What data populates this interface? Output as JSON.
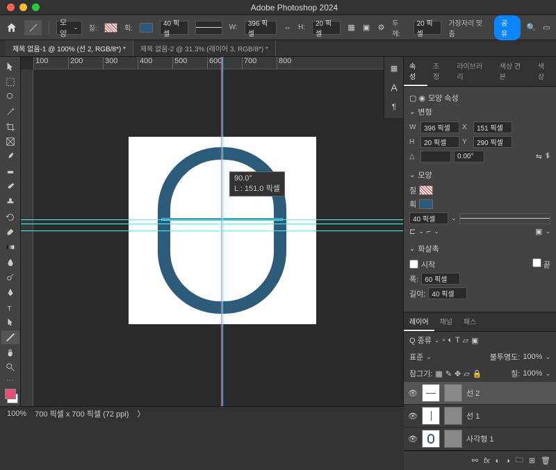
{
  "app": {
    "title": "Adobe Photoshop 2024"
  },
  "toolbar": {
    "shape_mode": "모양",
    "fill_label": "칠:",
    "stroke_label": "획:",
    "stroke_width": "40 픽셀",
    "w_label": "W:",
    "w_value": "396 픽셀",
    "h_label": "H:",
    "h_value": "20 픽셀",
    "thickness_label": "두께:",
    "thickness_value": "20 픽셀",
    "align_label": "가장자리 맞춤",
    "share": "공유"
  },
  "tabs": [
    {
      "label": "제목 없음-1 @ 100% (선 2, RGB/8*) *",
      "active": true
    },
    {
      "label": "제목 없음-2 @ 31.3% (레이어 3, RGB/8*) *",
      "active": false
    }
  ],
  "ruler_marks": [
    "100",
    "200",
    "300",
    "400",
    "500",
    "600",
    "700",
    "800"
  ],
  "tooltip": {
    "angle": "90.0°",
    "length": "L : 151.0 픽셀"
  },
  "properties": {
    "tabs": [
      "속성",
      "조정",
      "라이브러리",
      "색상 견본",
      "색상"
    ],
    "active_tab": "속성",
    "title": "모양 속성",
    "transform": {
      "label": "변형",
      "w": "396 픽셀",
      "x": "151 픽셀",
      "h": "20 픽셀",
      "y": "290 픽셀",
      "angle": "0.00°"
    },
    "shape": {
      "label": "모양",
      "fill_label": "칠",
      "stroke_label": "획",
      "stroke_width": "40 픽셀"
    },
    "arrowhead": {
      "label": "화살촉",
      "start": "시작",
      "end": "끝",
      "width_label": "폭:",
      "width": "60 픽셀",
      "length_label": "길이:",
      "length": "40 픽셀"
    }
  },
  "layers_panel": {
    "tabs": [
      "레이어",
      "채널",
      "패스"
    ],
    "active_tab": "레이어",
    "kind": "Q 종류",
    "blend": "표준",
    "opacity_label": "불투명도:",
    "opacity": "100%",
    "lock_label": "잠그기:",
    "fill_label": "칠:",
    "fill": "100%",
    "items": [
      {
        "name": "선 2",
        "selected": true
      },
      {
        "name": "선 1",
        "selected": false
      },
      {
        "name": "사각형 1",
        "selected": false
      }
    ]
  },
  "status": {
    "zoom": "100%",
    "doc": "700 픽셀 x 700 픽셀 (72 ppi)"
  },
  "colors": {
    "shape": "#2d5c7a",
    "accent": "#0a84ff"
  }
}
